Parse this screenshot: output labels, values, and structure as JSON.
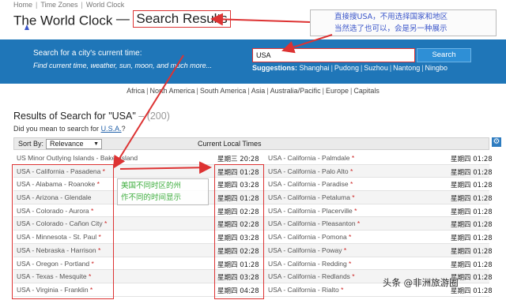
{
  "breadcrumb": [
    "Home",
    "Time Zones",
    "World Clock"
  ],
  "title": {
    "main": "The World Clock",
    "dash": "—",
    "boxed": "Search Results"
  },
  "annotation_top": {
    "line1": "直接搜USA，不用选择国家和地区",
    "line2": "当然选了也可以，会是另一种展示"
  },
  "search": {
    "heading": "Search for a city's current time:",
    "subheading": "Find current time, weather, sun, moon, and much more...",
    "value": "USA",
    "button": "Search",
    "suggestions_label": "Suggestions:",
    "suggestions": [
      "Shanghai",
      "Pudong",
      "Suzhou",
      "Nantong",
      "Ningbo"
    ]
  },
  "continents": [
    "Africa",
    "North America",
    "South America",
    "Asia",
    "Australia/Pacific",
    "Europe",
    "Capitals"
  ],
  "results": {
    "title": "Results of Search for \"USA\"",
    "count": "– (200)",
    "did_you_mean_prefix": "Did you mean to search for ",
    "did_you_mean_link": "U.S.A.",
    "did_you_mean_suffix": "?",
    "sort_label": "Sort By:",
    "sort_value": "Relevance",
    "column_title": "Current Local Times",
    "rows": [
      {
        "left_city": "US Minor Outlying Islands - Baker Island",
        "left_dst": false,
        "left_time": "星期三 20:28",
        "right_city": "USA - California - Palmdale",
        "right_dst": true,
        "right_time": "星期四 01:28"
      },
      {
        "left_city": "USA - California - Pasadena",
        "left_dst": true,
        "left_time": "星期四 01:28",
        "right_city": "USA - California - Palo Alto",
        "right_dst": true,
        "right_time": "星期四 01:28"
      },
      {
        "left_city": "USA - Alabama - Roanoke",
        "left_dst": true,
        "left_time": "星期四 03:28",
        "right_city": "USA - California - Paradise",
        "right_dst": true,
        "right_time": "星期四 01:28"
      },
      {
        "left_city": "USA - Arizona - Glendale",
        "left_dst": false,
        "left_time": "星期四 01:28",
        "right_city": "USA - California - Petaluma",
        "right_dst": true,
        "right_time": "星期四 01:28"
      },
      {
        "left_city": "USA - Colorado - Aurora",
        "left_dst": true,
        "left_time": "星期四 02:28",
        "right_city": "USA - California - Placerville",
        "right_dst": true,
        "right_time": "星期四 01:28"
      },
      {
        "left_city": "USA - Colorado - Cañon City",
        "left_dst": true,
        "left_time": "星期四 02:28",
        "right_city": "USA - California - Pleasanton",
        "right_dst": true,
        "right_time": "星期四 01:28"
      },
      {
        "left_city": "USA - Minnesota - St. Paul",
        "left_dst": true,
        "left_time": "星期四 03:28",
        "right_city": "USA - California - Pomona",
        "right_dst": true,
        "right_time": "星期四 01:28"
      },
      {
        "left_city": "USA - Nebraska - Harrison",
        "left_dst": true,
        "left_time": "星期四 02:28",
        "right_city": "USA - California - Poway",
        "right_dst": true,
        "right_time": "星期四 01:28"
      },
      {
        "left_city": "USA - Oregon - Portland",
        "left_dst": true,
        "left_time": "星期四 01:28",
        "right_city": "USA - California - Redding",
        "right_dst": true,
        "right_time": "星期四 01:28"
      },
      {
        "left_city": "USA - Texas - Mesquite",
        "left_dst": true,
        "left_time": "星期四 03:28",
        "right_city": "USA - California - Redlands",
        "right_dst": true,
        "right_time": "星期四 01:28"
      },
      {
        "left_city": "USA - Virginia - Franklin",
        "left_dst": true,
        "left_time": "星期四 04:28",
        "right_city": "USA - California - Rialto",
        "right_dst": true,
        "right_time": "星期四 01:28"
      }
    ]
  },
  "annotation_mid": {
    "line1": "美国不同时区的州",
    "line2": "作不同的时间显示"
  },
  "watermark": "头条 @非洲旅游圈",
  "colors": {
    "band": "#1f76b8",
    "annotation_red": "#dd3333",
    "annotation_blue": "#3a55c9",
    "annotation_green": "#3cad3c"
  }
}
